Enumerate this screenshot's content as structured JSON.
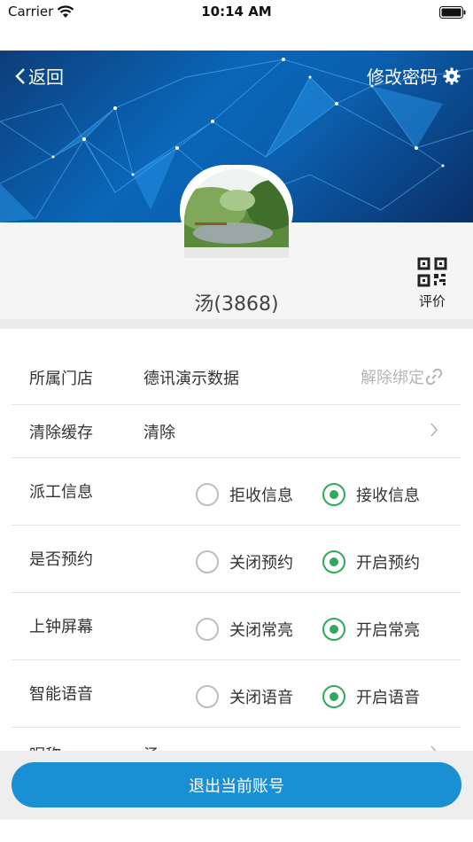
{
  "status_bar": {
    "carrier": "Carrier",
    "time": "10:14 AM"
  },
  "header": {
    "back_label": "返回",
    "change_password_label": "修改密码",
    "accent_color": "#0a66b8"
  },
  "profile": {
    "username": "汤(3868)",
    "qr_label": "评价"
  },
  "settings": {
    "store": {
      "label": "所属门店",
      "value": "德讯演示数据",
      "action": "解除绑定"
    },
    "cache": {
      "label": "清除缓存",
      "value": "清除"
    },
    "dispatch": {
      "label": "派工信息",
      "off": "拒收信息",
      "on": "接收信息",
      "selected": "on"
    },
    "booking": {
      "label": "是否预约",
      "off": "关闭预约",
      "on": "开启预约",
      "selected": "on"
    },
    "screen": {
      "label": "上钟屏幕",
      "off": "关闭常亮",
      "on": "开启常亮",
      "selected": "on"
    },
    "voice": {
      "label": "智能语音",
      "off": "关闭语音",
      "on": "开启语音",
      "selected": "on"
    },
    "nickname": {
      "label": "昵称",
      "value": "汤"
    }
  },
  "footer": {
    "logout_label": "退出当前账号",
    "button_color": "#1a8fd4"
  },
  "colors": {
    "radio_selected": "#2daa5a"
  }
}
